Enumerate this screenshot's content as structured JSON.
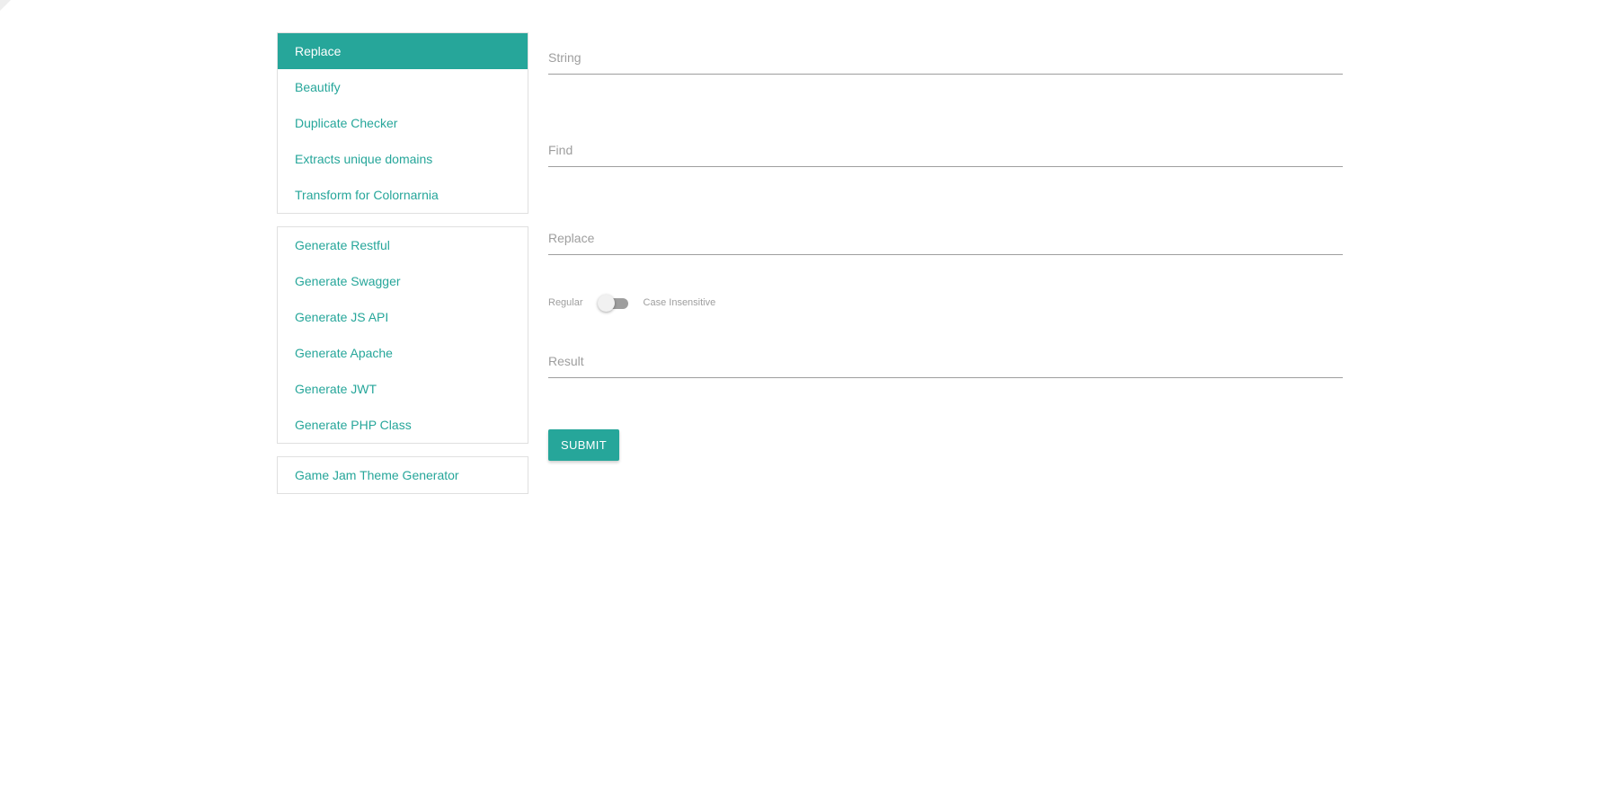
{
  "sidebar": {
    "groups": [
      {
        "items": [
          {
            "label": "Replace",
            "active": true
          },
          {
            "label": "Beautify"
          },
          {
            "label": "Duplicate Checker"
          },
          {
            "label": "Extracts unique domains"
          },
          {
            "label": "Transform for Colornarnia"
          }
        ]
      },
      {
        "items": [
          {
            "label": "Generate Restful"
          },
          {
            "label": "Generate Swagger"
          },
          {
            "label": "Generate JS API"
          },
          {
            "label": "Generate Apache"
          },
          {
            "label": "Generate JWT"
          },
          {
            "label": "Generate PHP Class"
          }
        ]
      },
      {
        "items": [
          {
            "label": "Game Jam Theme Generator"
          }
        ]
      }
    ]
  },
  "form": {
    "string_placeholder": "String",
    "string_value": "",
    "find_placeholder": "Find",
    "find_value": "",
    "replace_placeholder": "Replace",
    "replace_value": "",
    "switch_left_label": "Regular",
    "switch_right_label": "Case Insensitive",
    "switch_checked": false,
    "result_placeholder": "Result",
    "result_value": "",
    "submit_label": "SUBMIT"
  },
  "colors": {
    "accent": "#26a69a",
    "border": "#e0e0e0",
    "underline": "#9e9e9e"
  }
}
